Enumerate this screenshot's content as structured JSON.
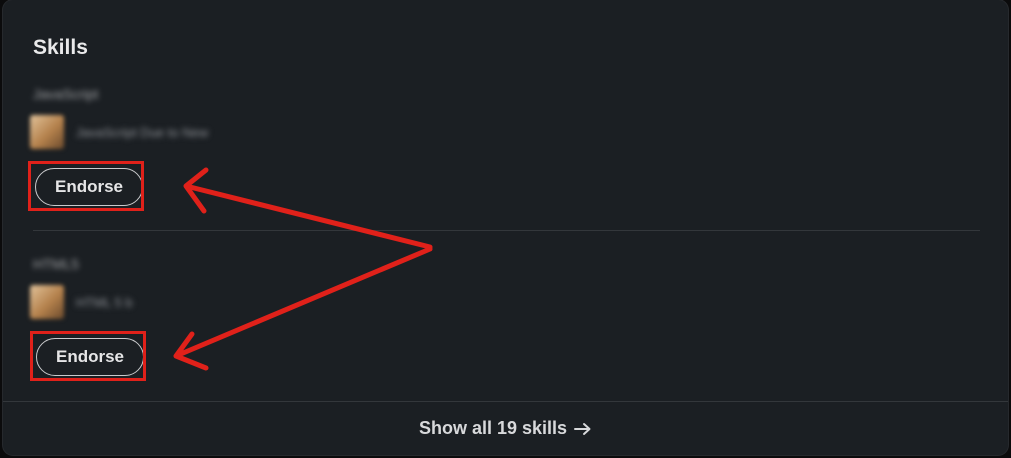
{
  "card": {
    "title": "Skills"
  },
  "skills": [
    {
      "name": "JavaScript",
      "endorser_text": "JavaScript Due to New",
      "endorse_label": "Endorse"
    },
    {
      "name": "HTML5",
      "endorser_text": "HTML 5 b",
      "endorse_label": "Endorse"
    }
  ],
  "footer": {
    "show_all_label": "Show all 19 skills",
    "icon": "arrow-right-icon"
  },
  "colors": {
    "card_bg": "#1b1f23",
    "annotation_red": "#e0211a",
    "text_primary": "#e9e9ea"
  }
}
